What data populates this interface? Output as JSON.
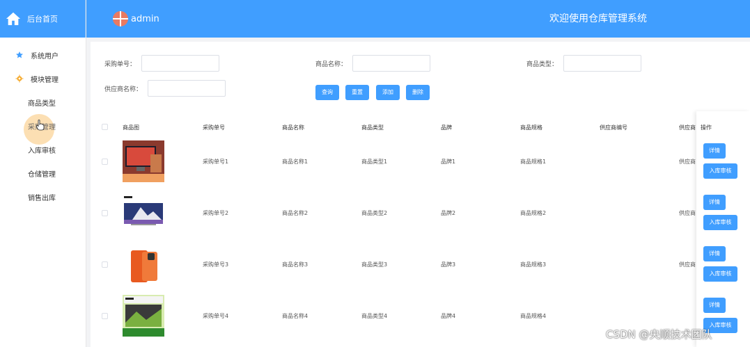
{
  "brand": {
    "label": "后台首页"
  },
  "header": {
    "user": "admin",
    "title": "欢迎使用仓库管理系统"
  },
  "sidebar": {
    "items": [
      {
        "label": "系统用户"
      },
      {
        "label": "模块管理"
      },
      {
        "label": "商品类型"
      },
      {
        "label": "采购管理"
      },
      {
        "label": "入库审核"
      },
      {
        "label": "仓储管理"
      },
      {
        "label": "销售出库"
      }
    ]
  },
  "filters": {
    "purchase_no": {
      "label": "采购单号：",
      "value": "",
      "placeholder": ""
    },
    "product_name": {
      "label": "商品名称：",
      "value": "",
      "placeholder": ""
    },
    "product_type": {
      "label": "商品类型：",
      "value": "",
      "placeholder": ""
    },
    "supplier_name": {
      "label": "供应商名称：",
      "value": "",
      "placeholder": ""
    }
  },
  "toolbar": {
    "query": "查询",
    "reset": "重置",
    "add": "添加",
    "delete": "删除"
  },
  "table": {
    "columns": [
      "商品图",
      "采购单号",
      "商品名称",
      "商品类型",
      "品牌",
      "商品规格",
      "供应商编号",
      "供应商",
      "操作"
    ],
    "rows": [
      {
        "purchase_no": "采购单号1",
        "product_name": "商品名称1",
        "product_type": "商品类型1",
        "brand": "品牌1",
        "spec": "商品规格1",
        "supplier": "供应商"
      },
      {
        "purchase_no": "采购单号2",
        "product_name": "商品名称2",
        "product_type": "商品类型2",
        "brand": "品牌2",
        "spec": "商品规格2",
        "supplier": "供应商"
      },
      {
        "purchase_no": "采购单号3",
        "product_name": "商品名称3",
        "product_type": "商品类型3",
        "brand": "品牌3",
        "spec": "商品规格3",
        "supplier": "供应商"
      },
      {
        "purchase_no": "采购单号4",
        "product_name": "商品名称4",
        "product_type": "商品类型4",
        "brand": "品牌4",
        "spec": "商品规格4",
        "supplier": ""
      }
    ],
    "actions": {
      "detail": "详情",
      "audit": "入库审核"
    }
  },
  "watermark": "CSDN @央顺技术团队",
  "colors": {
    "primary": "#409eff",
    "highlight": "#fbd9a6",
    "background": "#f2f3f5"
  }
}
